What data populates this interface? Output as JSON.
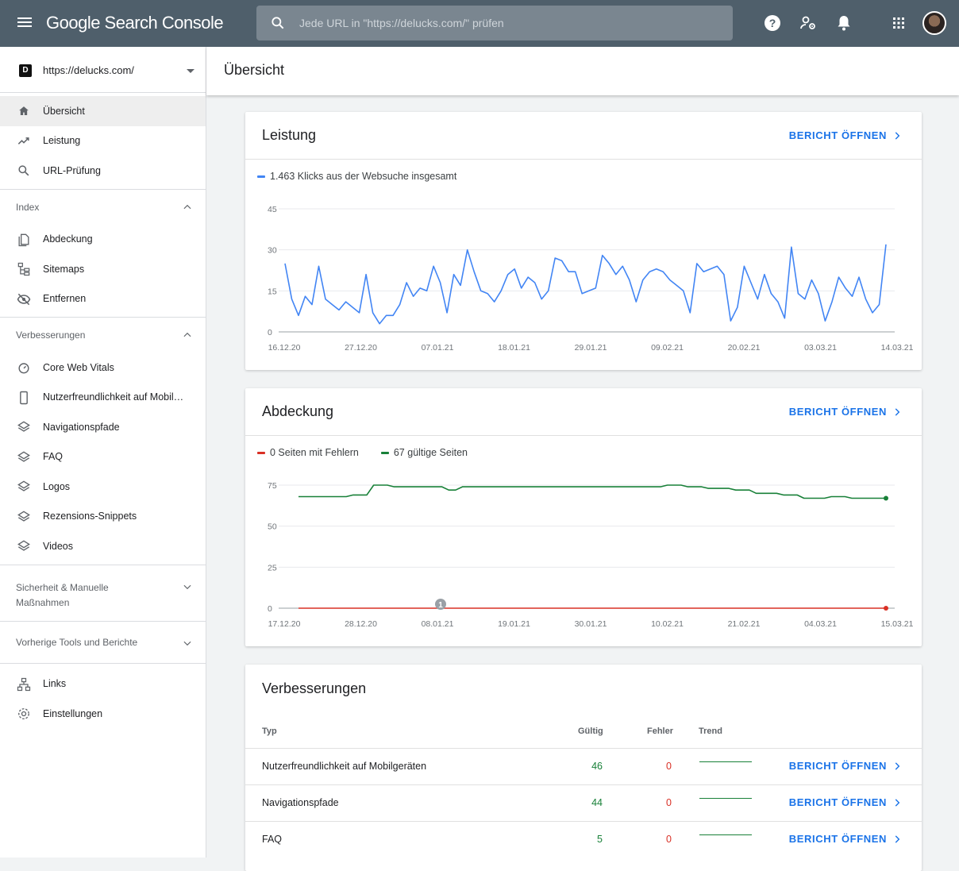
{
  "app": {
    "title": "Google Search Console"
  },
  "search": {
    "placeholder": "Jede URL in \"https://delucks.com/\" prüfen"
  },
  "property": {
    "url": "https://delucks.com/",
    "favicon_letter": "D"
  },
  "sidebar": {
    "main_items": [
      {
        "label": "Übersicht",
        "icon": "home-icon",
        "active": true
      },
      {
        "label": "Leistung",
        "icon": "trending-up-icon"
      },
      {
        "label": "URL-Prüfung",
        "icon": "search-icon"
      }
    ],
    "index": {
      "heading": "Index",
      "items": [
        {
          "label": "Abdeckung",
          "icon": "file-copy-icon"
        },
        {
          "label": "Sitemaps",
          "icon": "sitemap-icon"
        },
        {
          "label": "Entfernen",
          "icon": "visibility-off-icon"
        }
      ]
    },
    "improvements": {
      "heading": "Verbesserungen",
      "items": [
        {
          "label": "Core Web Vitals",
          "icon": "speed-gauge-icon"
        },
        {
          "label": "Nutzerfreundlichkeit auf Mobilgeräten",
          "icon": "smartphone-icon"
        },
        {
          "label": "Navigationspfade",
          "icon": "layers-icon"
        },
        {
          "label": "FAQ",
          "icon": "layers-icon"
        },
        {
          "label": "Logos",
          "icon": "layers-icon"
        },
        {
          "label": "Rezensions-Snippets",
          "icon": "layers-icon"
        },
        {
          "label": "Videos",
          "icon": "layers-icon"
        }
      ]
    },
    "security": {
      "heading": "Sicherheit & Manuelle Maßnahmen"
    },
    "legacy": {
      "heading": "Vorherige Tools und Berichte"
    },
    "bottom_items": [
      {
        "label": "Links",
        "icon": "links-network-icon"
      },
      {
        "label": "Einstellungen",
        "icon": "settings-gear-icon"
      }
    ]
  },
  "page": {
    "title": "Übersicht"
  },
  "performance": {
    "title": "Leistung",
    "report_label": "BERICHT ÖFFNEN",
    "legend": "1.463 Klicks aus der Websuche insgesamt",
    "color": "#4285f4"
  },
  "coverage": {
    "title": "Abdeckung",
    "report_label": "BERICHT ÖFFNEN",
    "legend_errors": "0 Seiten mit Fehlern",
    "legend_valid": "67 gültige Seiten",
    "error_color": "#d93025",
    "valid_color": "#188038",
    "annotation": "1"
  },
  "enhancements": {
    "title": "Verbesserungen",
    "columns": {
      "type": "Typ",
      "valid": "Gültig",
      "errors": "Fehler",
      "trend": "Trend"
    },
    "rows": [
      {
        "type": "Nutzerfreundlichkeit auf Mobilgeräten",
        "valid": "46",
        "errors": "0",
        "report_label": "BERICHT ÖFFNEN"
      },
      {
        "type": "Navigationspfade",
        "valid": "44",
        "errors": "0",
        "report_label": "BERICHT ÖFFNEN"
      },
      {
        "type": "FAQ",
        "valid": "5",
        "errors": "0",
        "report_label": "BERICHT ÖFFNEN"
      }
    ]
  },
  "chart_data": [
    {
      "type": "line",
      "title": "Leistung",
      "x_ticks": [
        "16.12.20",
        "27.12.20",
        "07.01.21",
        "18.01.21",
        "29.01.21",
        "09.02.21",
        "20.02.21",
        "03.03.21",
        "14.03.21"
      ],
      "ylim": [
        0,
        45
      ],
      "y_ticks": [
        0,
        15,
        30,
        45
      ],
      "grid": true,
      "series": [
        {
          "name": "1.463 Klicks aus der Websuche insgesamt",
          "values": [
            25,
            12,
            6,
            13,
            10,
            24,
            12,
            10,
            8,
            11,
            9,
            7,
            21,
            7,
            3,
            6,
            6,
            10,
            18,
            13,
            16,
            15,
            24,
            18,
            7,
            21,
            17,
            30,
            22,
            15,
            14,
            11,
            15,
            21,
            23,
            16,
            20,
            18,
            12,
            15,
            27,
            26,
            22,
            22,
            14,
            15,
            16,
            28,
            25,
            21,
            24,
            19,
            11,
            19,
            22,
            23,
            22,
            19,
            17,
            15,
            7,
            25,
            22,
            23,
            24,
            21,
            4,
            9,
            24,
            18,
            12,
            21,
            14,
            11,
            5,
            31,
            14,
            12,
            19,
            14,
            4,
            11,
            20,
            16,
            13,
            20,
            12,
            7,
            10,
            32
          ]
        }
      ]
    },
    {
      "type": "line",
      "title": "Abdeckung",
      "x_ticks": [
        "17.12.20",
        "28.12.20",
        "08.01.21",
        "19.01.21",
        "30.01.21",
        "10.02.21",
        "21.02.21",
        "04.03.21",
        "15.03.21"
      ],
      "ylim": [
        0,
        75
      ],
      "y_ticks": [
        0,
        25,
        50,
        75
      ],
      "grid": true,
      "series": [
        {
          "name": "67 gültige Seiten",
          "values": [
            68,
            68,
            68,
            68,
            68,
            68,
            68,
            68,
            69,
            69,
            69,
            75,
            75,
            75,
            74,
            74,
            74,
            74,
            74,
            74,
            74,
            74,
            72,
            72,
            74,
            74,
            74,
            74,
            74,
            74,
            74,
            74,
            74,
            74,
            74,
            74,
            74,
            74,
            74,
            74,
            74,
            74,
            74,
            74,
            74,
            74,
            74,
            74,
            74,
            74,
            74,
            74,
            74,
            74,
            75,
            75,
            75,
            74,
            74,
            74,
            73,
            73,
            73,
            73,
            72,
            72,
            72,
            70,
            70,
            70,
            70,
            69,
            69,
            69,
            67,
            67,
            67,
            67,
            68,
            68,
            68,
            67,
            67,
            67,
            67,
            67,
            67
          ]
        },
        {
          "name": "0 Seiten mit Fehlern",
          "values": [
            0,
            0,
            0,
            0,
            0,
            0,
            0,
            0,
            0,
            0,
            0,
            0,
            0,
            0,
            0,
            0,
            0,
            0,
            0,
            0,
            0,
            0,
            0,
            0,
            0,
            0,
            0,
            0,
            0,
            0,
            0,
            0,
            0,
            0,
            0,
            0,
            0,
            0,
            0,
            0,
            0,
            0,
            0,
            0,
            0,
            0,
            0,
            0,
            0,
            0,
            0,
            0,
            0,
            0,
            0,
            0,
            0,
            0,
            0,
            0,
            0,
            0,
            0,
            0,
            0,
            0,
            0,
            0,
            0,
            0,
            0,
            0,
            0,
            0,
            0,
            0,
            0,
            0,
            0,
            0,
            0,
            0,
            0,
            0,
            0,
            0,
            0
          ]
        }
      ]
    }
  ]
}
